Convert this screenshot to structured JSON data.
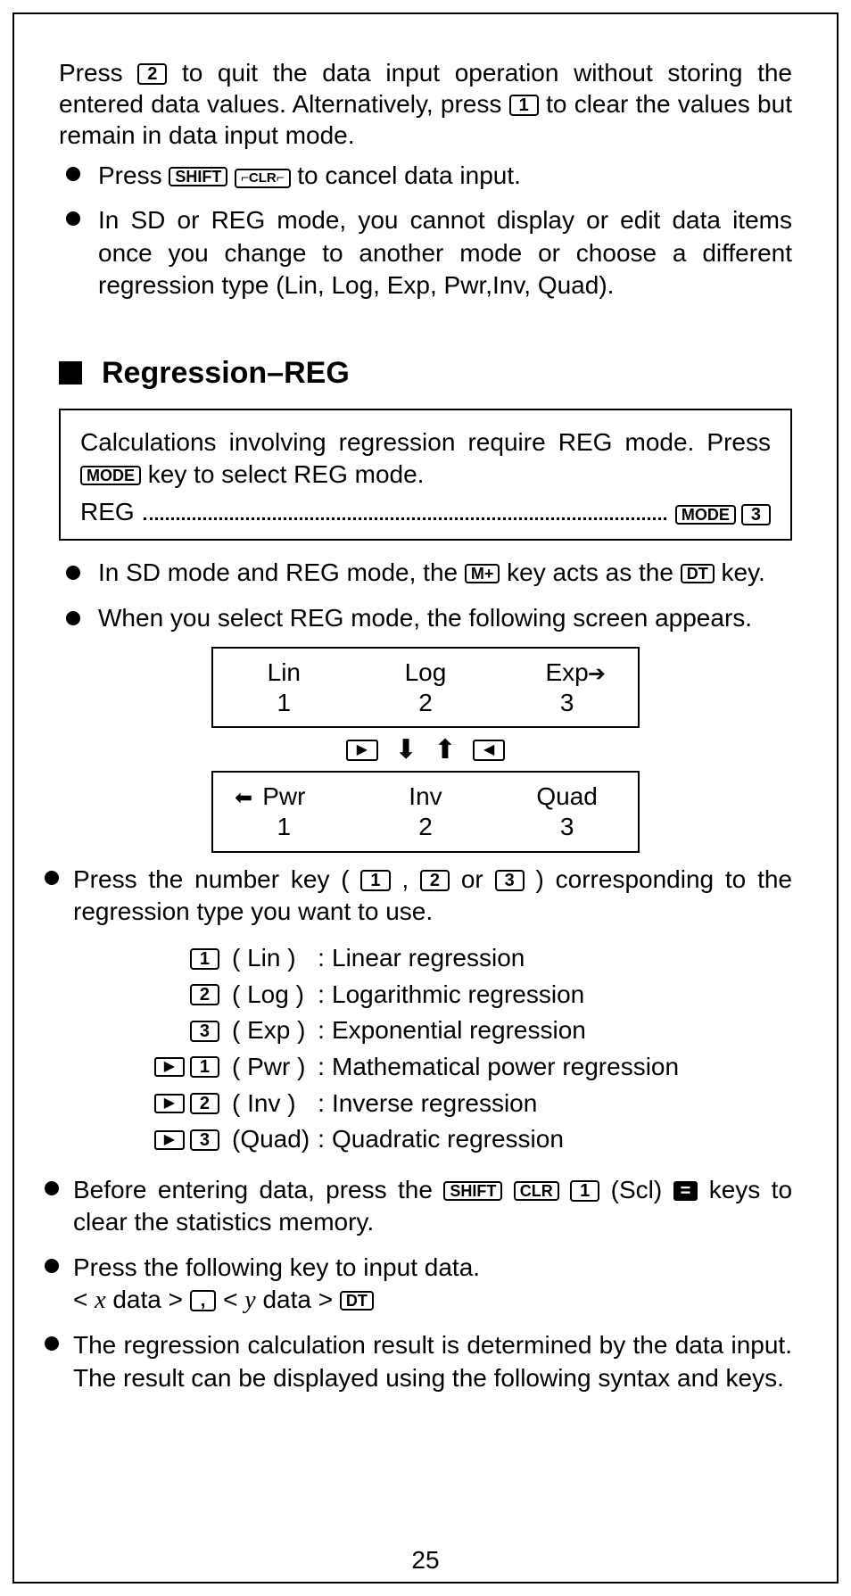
{
  "keys": {
    "k1": "1",
    "k2": "2",
    "k3": "3",
    "shift": "SHIFT",
    "clr": "CLR",
    "clr_corner": "⌐CLR⌐",
    "mode": "MODE",
    "mplus": "M+",
    "dt": "DT",
    "comma": ",",
    "right": "▶",
    "left": "◀",
    "eq": "="
  },
  "intro": {
    "p1a": "Press ",
    "p1b": " to quit the data input operation without storing the entered data values. Alternatively, press ",
    "p1c": " to clear the values but remain in data input mode."
  },
  "bullets1": {
    "b1a": "Press ",
    "b1b": " to cancel data input.",
    "b2": "In SD or REG mode, you cannot display or edit data items once you change to another mode or choose a different regression type (Lin, Log, Exp, Pwr,Inv, Quad)."
  },
  "section": {
    "title": "Regression–REG"
  },
  "infobox": {
    "p1a": "Calculations involving regression require REG mode. Press ",
    "p1b": " key to select REG mode.",
    "left": "REG"
  },
  "bullets2": {
    "b1a": "In SD mode and REG mode, the ",
    "b1b": " key acts as the ",
    "b1c": " key.",
    "b2": "When you select REG mode, the following screen appears."
  },
  "screen1": {
    "c1": "Lin",
    "c2": "Log",
    "c3": "Exp",
    "n1": "1",
    "n2": "2",
    "n3": "3"
  },
  "screen2": {
    "c1": "Pwr",
    "c2": "Inv",
    "c3": "Quad",
    "n1": "1",
    "n2": "2",
    "n3": "3"
  },
  "bullets3": {
    "b1a": "Press the number key ( ",
    "b1b": " , ",
    "b1c": " or ",
    "b1d": " ) corresponding to the regression type you want to use."
  },
  "regtypes": [
    {
      "prefix": "",
      "num": "1",
      "abbr": "( Lin )",
      "desc": "Linear regression"
    },
    {
      "prefix": "",
      "num": "2",
      "abbr": "( Log )",
      "desc": "Logarithmic regression"
    },
    {
      "prefix": "",
      "num": "3",
      "abbr": "( Exp )",
      "desc": "Exponential regression"
    },
    {
      "prefix": "▶",
      "num": "1",
      "abbr": "( Pwr )",
      "desc": "Mathematical power regression"
    },
    {
      "prefix": "▶",
      "num": "2",
      "abbr": "( Inv )",
      "desc": "Inverse regression"
    },
    {
      "prefix": "▶",
      "num": "3",
      "abbr": "(Quad)",
      "desc": "Quadratic regression"
    }
  ],
  "bullets4": {
    "b1a": "Before entering data, press the ",
    "b1b": " (Scl) ",
    "b1c": " keys to clear the statistics memory.",
    "b2a": "Press the following key to input data.",
    "b2b_1": "< ",
    "b2b_x": "x",
    "b2b_2": " data > ",
    "b2b_3": " < ",
    "b2b_y": "y",
    "b2b_4": " data > ",
    "b3": "The regression calculation result is determined by the data input.  The result can be displayed using the following syntax and keys."
  },
  "pageNumber": "25"
}
